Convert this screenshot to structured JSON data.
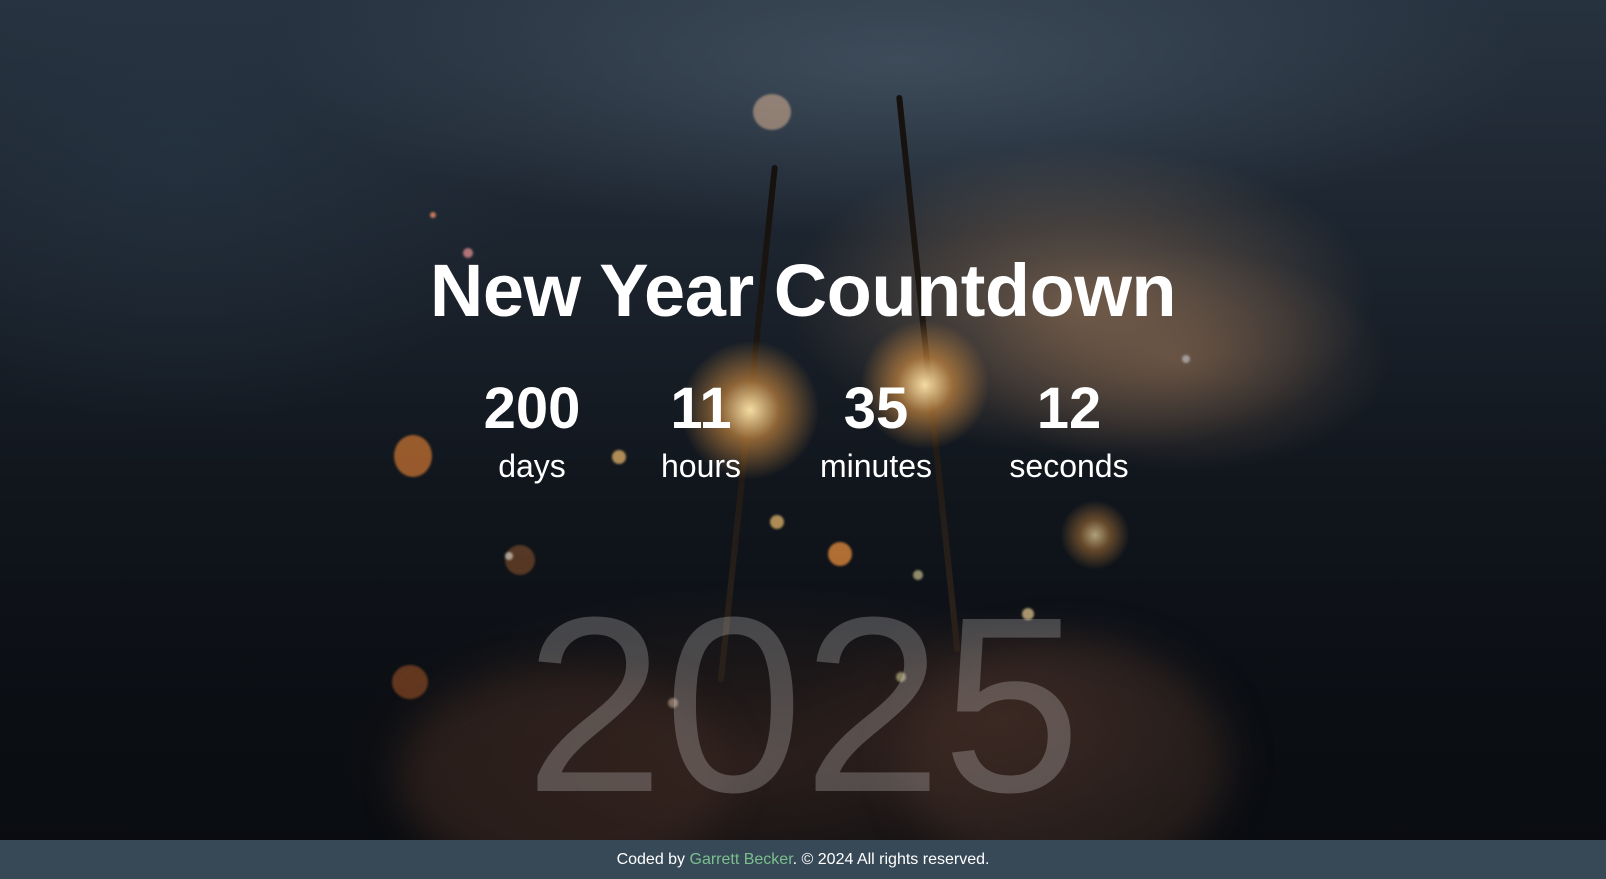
{
  "page": {
    "title": "New Year Countdown",
    "background_image": "sparklers-night-photo"
  },
  "countdown": [
    {
      "value": "200",
      "label": "days"
    },
    {
      "value": "11",
      "label": "hours"
    },
    {
      "value": "35",
      "label": "minutes"
    },
    {
      "value": "12",
      "label": "seconds"
    }
  ],
  "year": "2025",
  "footer": {
    "prefix": "Coded by ",
    "author": "Garrett Becker",
    "suffix": ". © 2024 All rights reserved."
  },
  "colors": {
    "footer_bg": "#374957",
    "link": "#7bbf8e",
    "text": "#ffffff"
  }
}
